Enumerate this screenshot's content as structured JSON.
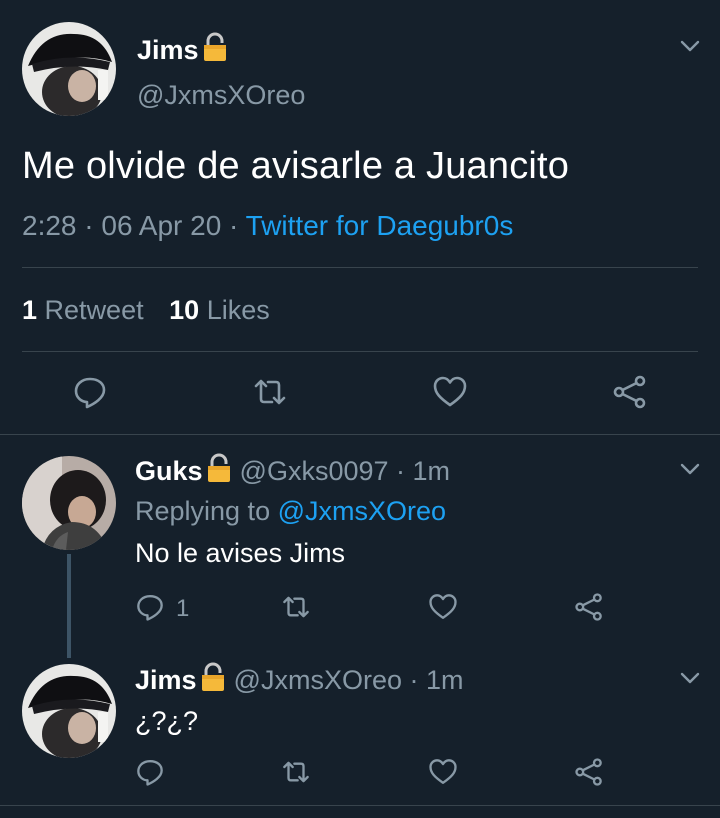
{
  "main_tweet": {
    "name": "Jims",
    "handle": "@JxmsXOreo",
    "text": "Me olvide de avisarle a Juancito",
    "time": "2:28",
    "date": "06 Apr 20",
    "source": "Twitter for Daegubr0s",
    "retweets": "1",
    "retweets_label": "Retweet",
    "likes": "10",
    "likes_label": "Likes"
  },
  "replies": [
    {
      "name": "Guks",
      "handle": "@Gxks0097 · 1m",
      "replying_prefix": "Replying to",
      "replying_handle": "@JxmsXOreo",
      "text": "No le avises Jims",
      "reply_count": "1"
    },
    {
      "name": "Jims",
      "handle": "@JxmsXOreo · 1m",
      "text": "¿?¿?"
    }
  ],
  "icons": {
    "reply": "speech-bubble-icon",
    "retweet": "retweet-arrows-icon",
    "like": "heart-icon",
    "share": "share-icon",
    "lock": "lock-icon",
    "menu": "chevron-down-icon"
  },
  "colors": {
    "background": "#15202b",
    "text": "#ffffff",
    "muted": "#8899a6",
    "link": "#1da1f2",
    "divider": "#38444d"
  }
}
